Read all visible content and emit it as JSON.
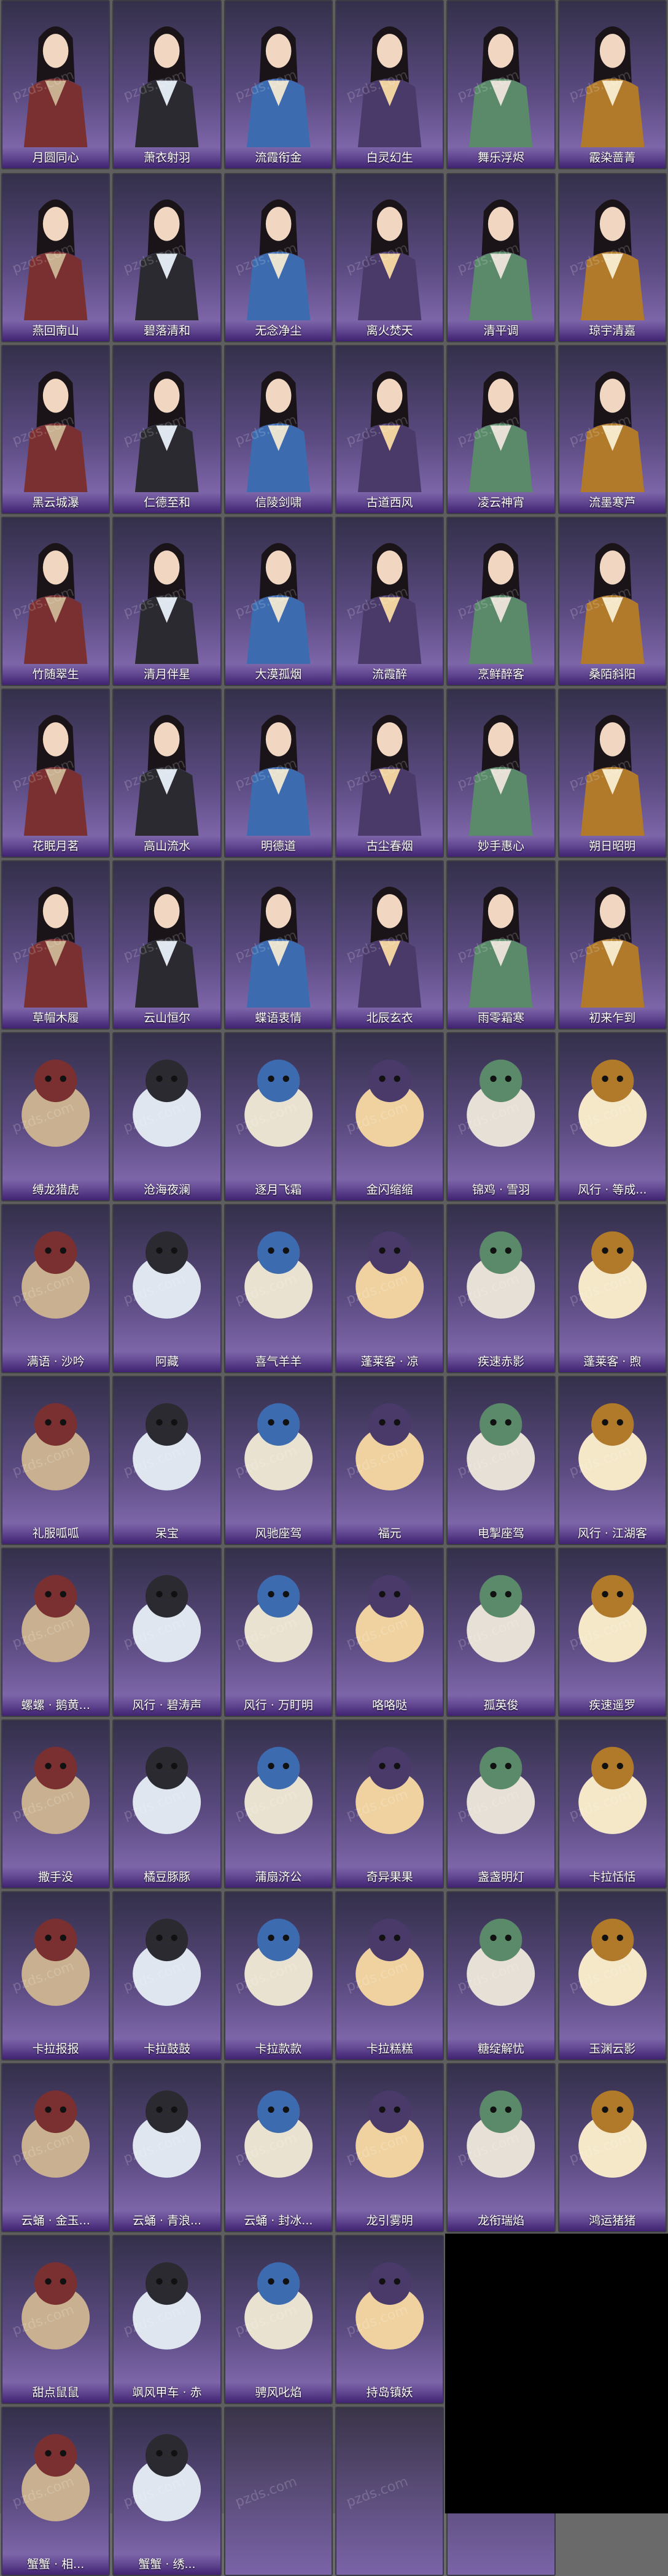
{
  "watermark": "pzds.com",
  "rows": [
    [
      "月圆同心",
      "萧衣射羽",
      "流霞衔金",
      "白灵幻生",
      "舞乐浮烬",
      "霰染蔷菁"
    ],
    [
      "燕回南山",
      "碧落清和",
      "无念净尘",
      "离火焚天",
      "清平调",
      "琼宇清嘉"
    ],
    [
      "黑云城瀑",
      "仁德至和",
      "信陵剑啸",
      "古道西风",
      "凌云神宵",
      "流墨寒芦"
    ],
    [
      "竹随翠生",
      "清月伴星",
      "大漠孤烟",
      "流霞醉",
      "烹鲜醉客",
      "桑陌斜阳"
    ],
    [
      "花眠月茗",
      "高山流水",
      "明德道",
      "古尘春烟",
      "妙手惠心",
      "朔日昭明"
    ],
    [
      "草帽木履",
      "云山恒尔",
      "蝶语衷情",
      "北辰玄衣",
      "雨零霜寒",
      "初来乍到"
    ],
    [
      "缚龙猎虎",
      "沧海夜澜",
      "逐月飞霜",
      "金闪缩缩",
      "锦鸡 · 雪羽",
      "风行 · 等成..."
    ],
    [
      "满语 · 沙吟",
      "阿藏",
      "喜气羊羊",
      "蓬莱客 · 凉",
      "疾速赤影",
      "蓬莱客 · 煦"
    ],
    [
      "礼服呱呱",
      "呆宝",
      "风驰座驾",
      "福元",
      "电掣座驾",
      "风行 · 江湖客"
    ],
    [
      "螺螺 · 鹅黄...",
      "风行 · 碧涛声",
      "风行 · 万盯明",
      "咯咯哒",
      "孤英俊",
      "疾速遥罗"
    ],
    [
      "撒手没",
      "橘豆豚豚",
      "蒲扇济公",
      "奇异果果",
      "盏盏明灯",
      "卡拉恬恬"
    ],
    [
      "卡拉报报",
      "卡拉鼓鼓",
      "卡拉款款",
      "卡拉糕糕",
      "糖绽解忧",
      "玉渊云影"
    ],
    [
      "云蛹 · 金玉...",
      "云蛹 · 青浪...",
      "云蛹 · 封冰...",
      "龙引雾明",
      "龙衔瑞焰",
      "鸿运猪猪"
    ],
    [
      "甜点鼠鼠",
      "飒风甲车 · 赤",
      "骋风叱焰",
      "持岛镇妖"
    ],
    [
      "蟹蟹 · 相...",
      "蟹蟹 · 绣...",
      "",
      "",
      ""
    ]
  ],
  "colors": {
    "panel_top": "#34304a",
    "panel_bottom": "#8a70b8",
    "label_text": "#ffffff",
    "background": "#5e5e5e"
  }
}
